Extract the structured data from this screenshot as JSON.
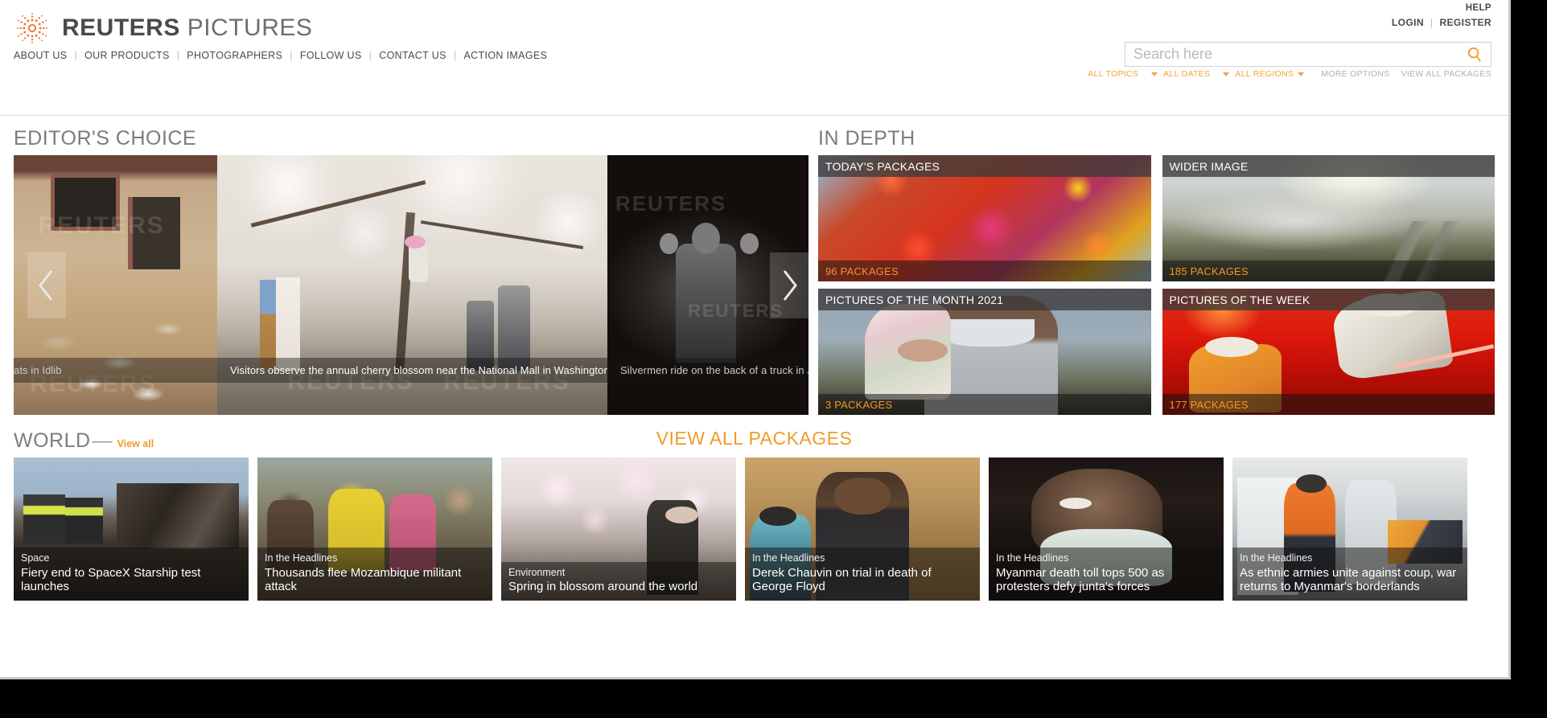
{
  "brand": {
    "name_bold": "REUTERS",
    "name_light": "PICTURES",
    "logo_icon": "reuters-sun-logo"
  },
  "header": {
    "nav": [
      {
        "label": "ABOUT US"
      },
      {
        "label": "OUR PRODUCTS"
      },
      {
        "label": "PHOTOGRAPHERS"
      },
      {
        "label": "FOLLOW US"
      },
      {
        "label": "CONTACT US"
      },
      {
        "label": "ACTION IMAGES"
      }
    ],
    "help": "HELP",
    "login": "LOGIN",
    "register": "REGISTER",
    "separator": "|"
  },
  "search": {
    "value": "",
    "placeholder": "Search here",
    "icon": "search-icon",
    "filters": [
      {
        "label": "ALL TOPICS",
        "has_caret": true
      },
      {
        "label": "ALL DATES",
        "has_caret": true
      },
      {
        "label": "ALL REGIONS",
        "has_caret": true
      }
    ],
    "more_options": "MORE OPTIONS",
    "view_all_packages": "VIEW ALL PACKAGES"
  },
  "editors_choice": {
    "heading": "EDITOR'S CHOICE",
    "prev_icon": "chevron-left-icon",
    "next_icon": "chevron-right-icon",
    "watermark": "REUTERS",
    "slides": [
      {
        "caption": "ats in Idlib",
        "alt": "stray cats gathered outside a stone building"
      },
      {
        "caption": "Visitors observe the annual cherry blossom near the National Mall in Washington",
        "alt": "people under cherry blossom trees by the water"
      },
      {
        "caption": "Silvermen ride on the back of a truck in Jakarta",
        "alt": "silver painted performers on a truck at night"
      }
    ]
  },
  "in_depth": {
    "heading": "IN DEPTH",
    "packages": [
      {
        "title": "TODAY'S PACKAGES",
        "count": "96 PACKAGES",
        "alt": "face covered in bright holi colour powder"
      },
      {
        "title": "WIDER IMAGE",
        "count": "185 PACKAGES",
        "alt": "misty river valley at sunrise"
      },
      {
        "title": "PICTURES OF THE MONTH 2021",
        "count": "3 PACKAGES",
        "alt": "man in face mask holding a child wrapped in a towel"
      },
      {
        "title": "PICTURES OF THE WEEK",
        "count": "177 PACKAGES",
        "alt": "rescue workers in red lit interior"
      }
    ]
  },
  "world": {
    "heading": "WORLD",
    "dash": "—",
    "view_all": "View all",
    "view_all_packages": "VIEW ALL PACKAGES",
    "items": [
      {
        "kicker": "Space",
        "headline": "Fiery end to SpaceX Starship test launches",
        "alt": "workers in hard hats beside charred wreckage"
      },
      {
        "kicker": "In the Headlines",
        "headline": "Thousands flee Mozambique militant attack",
        "alt": "crowd of people carrying belongings"
      },
      {
        "kicker": "Environment",
        "headline": "Spring in blossom around the world",
        "alt": "person photographing cherry blossom"
      },
      {
        "kicker": "In the Headlines",
        "headline": "Derek Chauvin on trial in death of George Floyd",
        "alt": "courtroom sketch of trial"
      },
      {
        "kicker": "In the Headlines",
        "headline": "Myanmar death toll tops 500 as protesters defy junta's forces",
        "alt": "protester wearing a face mask"
      },
      {
        "kicker": "In the Headlines",
        "headline": "As ethnic armies unite against coup, war returns to Myanmar's borderlands",
        "alt": "medics tending to a patient in an ambulance"
      }
    ]
  },
  "colors": {
    "brand_orange": "#ef9b2c",
    "heading_grey": "#7c7c7c",
    "nav_grey": "#4a4a4a"
  }
}
